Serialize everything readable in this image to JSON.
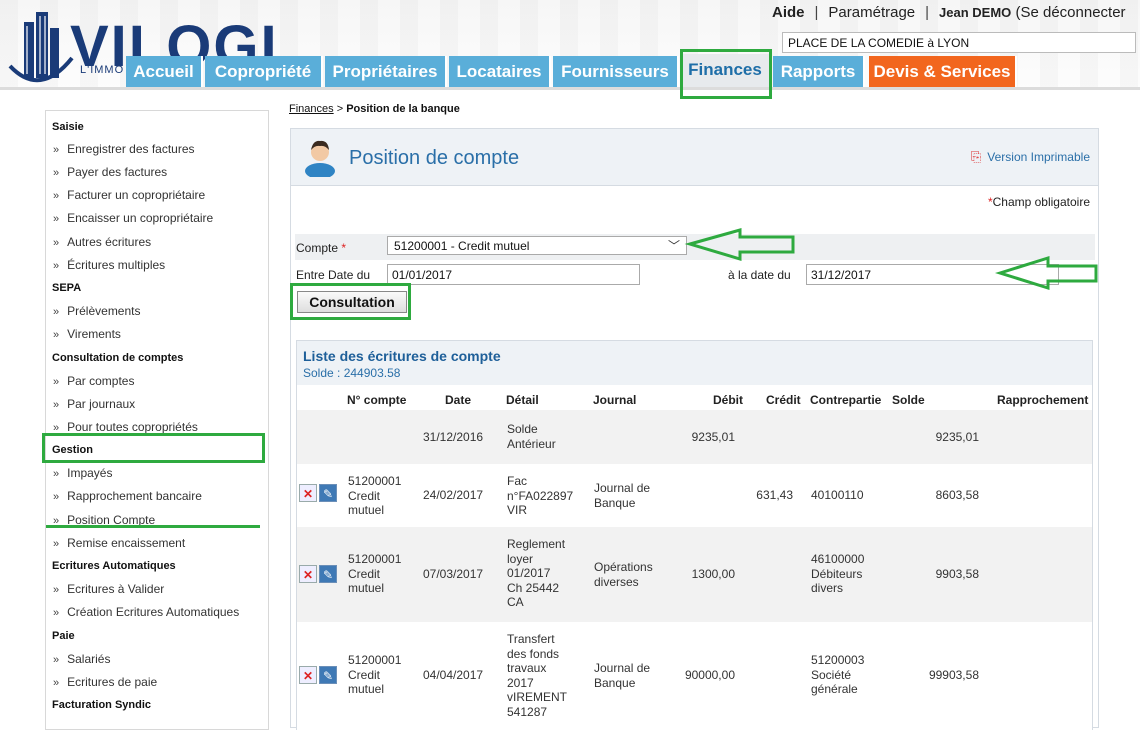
{
  "header": {
    "logo_text": "VILOGI",
    "logo_sub": "L'IMMO",
    "links": {
      "aide": "Aide",
      "sep1": "|",
      "parametrage": "Paramétrage",
      "sep2": "|",
      "user": "Jean DEMO",
      "logout": "(Se déconnecter"
    },
    "building": "PLACE DE LA COMEDIE à LYON",
    "tabs": [
      {
        "label": "Accueil"
      },
      {
        "label": "Copropriété"
      },
      {
        "label": "Propriétaires"
      },
      {
        "label": "Locataires"
      },
      {
        "label": "Fournisseurs"
      },
      {
        "label": "Finances"
      },
      {
        "label": "Rapports"
      },
      {
        "label": "Devis & Services"
      }
    ],
    "active_tab": "Finances"
  },
  "sidebar": {
    "sections": [
      {
        "title": "Saisie",
        "items": [
          "Enregistrer des factures",
          "Payer des factures",
          "Facturer un copropriétaire",
          "Encaisser un copropriétaire",
          "Autres écritures",
          "Écritures multiples"
        ]
      },
      {
        "title": "SEPA",
        "items": [
          "Prélèvements",
          "Virements"
        ]
      },
      {
        "title": "Consultation de comptes",
        "items": [
          "Par comptes",
          "Par journaux",
          "Pour toutes copropriétés"
        ]
      },
      {
        "title": "Gestion",
        "items": [
          "Impayés",
          "Rapprochement bancaire",
          "Position Compte",
          "Remise encaissement"
        ]
      },
      {
        "title": "Ecritures Automatiques",
        "items": [
          "Ecritures à Valider",
          "Création Ecritures Automatiques"
        ]
      },
      {
        "title": "Paie",
        "items": [
          "Salariés",
          "Ecritures de paie"
        ]
      },
      {
        "title": "Facturation Syndic",
        "items": []
      }
    ],
    "chevron": "»"
  },
  "breadcrumb": {
    "parent": "Finances",
    "sep": " > ",
    "current": "Position de la banque"
  },
  "panel": {
    "title": "Position de compte",
    "print_link": "Version Imprimable",
    "required_note": "Champ obligatoire",
    "form": {
      "compte_label": "Compte",
      "compte_value": "51200001 - Credit mutuel",
      "date_from_label": "Entre Date du",
      "date_from": "01/01/2017",
      "date_to_label": "à la date du",
      "date_to": "31/12/2017",
      "submit": "Consultation"
    },
    "list": {
      "title": "Liste des écritures de compte",
      "solde": "Solde : 244903.58",
      "headers": [
        "N° compte",
        "Date",
        "Détail",
        "Journal",
        "Débit",
        "Crédit",
        "Contrepartie",
        "Solde",
        "Rapprochement"
      ],
      "rows": [
        {
          "compte": "",
          "date": "31/12/2016",
          "detail": "Solde\nAntérieur",
          "journal": "",
          "debit": "9235,01",
          "credit": "",
          "contrepartie": "",
          "solde": "9235,01",
          "actions": false
        },
        {
          "compte": "51200001\nCredit\nmutuel",
          "date": "24/02/2017",
          "detail": "Fac\nn°FA022897\nVIR",
          "journal": "Journal de\nBanque",
          "debit": "",
          "credit": "631,43",
          "contrepartie": "40100110",
          "solde": "8603,58",
          "actions": true
        },
        {
          "compte": "51200001\nCredit\nmutuel",
          "date": "07/03/2017",
          "detail": "Reglement\nloyer\n01/2017\nCh 25442\nCA",
          "journal": "Opérations\ndiverses",
          "debit": "1300,00",
          "credit": "",
          "contrepartie": "46100000\nDébiteurs\ndivers",
          "solde": "9903,58",
          "actions": true
        },
        {
          "compte": "51200001\nCredit\nmutuel",
          "date": "04/04/2017",
          "detail": "Transfert\ndes fonds\ntravaux\n2017\nvIREMENT\n541287",
          "journal": "Journal de\nBanque",
          "debit": "90000,00",
          "credit": "",
          "contrepartie": "51200003\nSociété\ngénérale",
          "solde": "99903,58",
          "actions": true
        }
      ]
    }
  },
  "colors": {
    "tab_blue": "#5aaed9",
    "tab_orange": "#f2661e",
    "highlight_green": "#2eaa3f",
    "title_blue": "#2a6fa8"
  }
}
